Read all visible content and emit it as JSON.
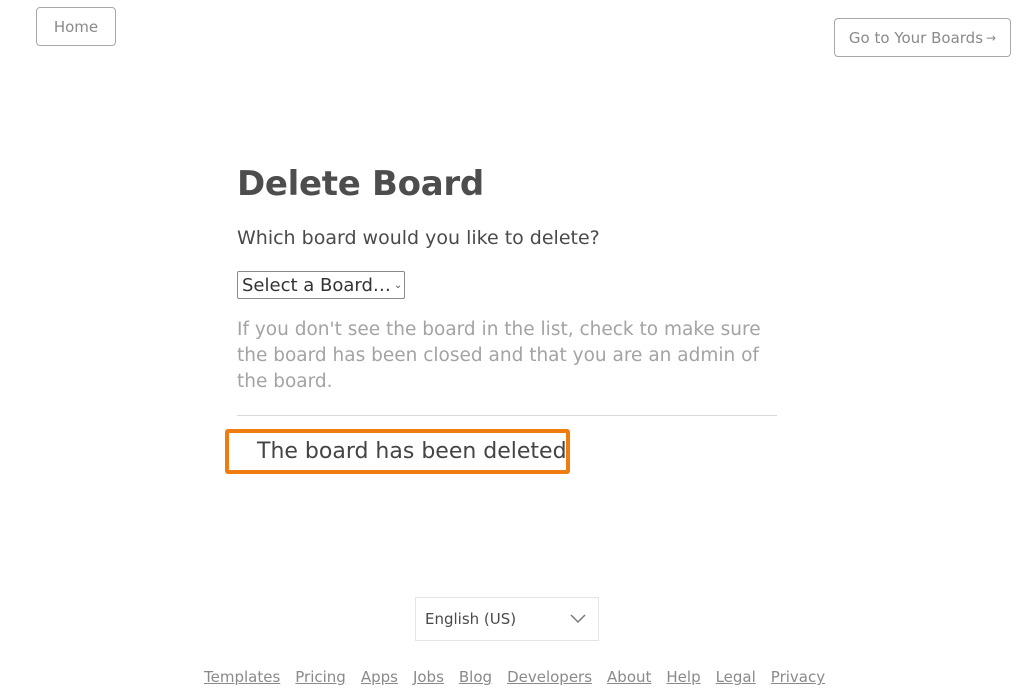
{
  "header": {
    "home_label": "Home",
    "boards_label": "Go to Your Boards",
    "boards_arrow": "→"
  },
  "main": {
    "title": "Delete Board",
    "prompt": "Which board would you like to delete?",
    "select": {
      "selected": "Select a Board…",
      "chevron": "⌄"
    },
    "hint": "If you don't see the board in the list, check to make sure the board has been closed and that you are an admin of the board.",
    "status_message": "The board has been deleted",
    "highlight_color": "#f07c0f"
  },
  "language": {
    "selected": "English (US)"
  },
  "footer": {
    "links": [
      "Templates",
      "Pricing",
      "Apps",
      "Jobs",
      "Blog",
      "Developers",
      "About",
      "Help",
      "Legal",
      "Privacy"
    ]
  }
}
